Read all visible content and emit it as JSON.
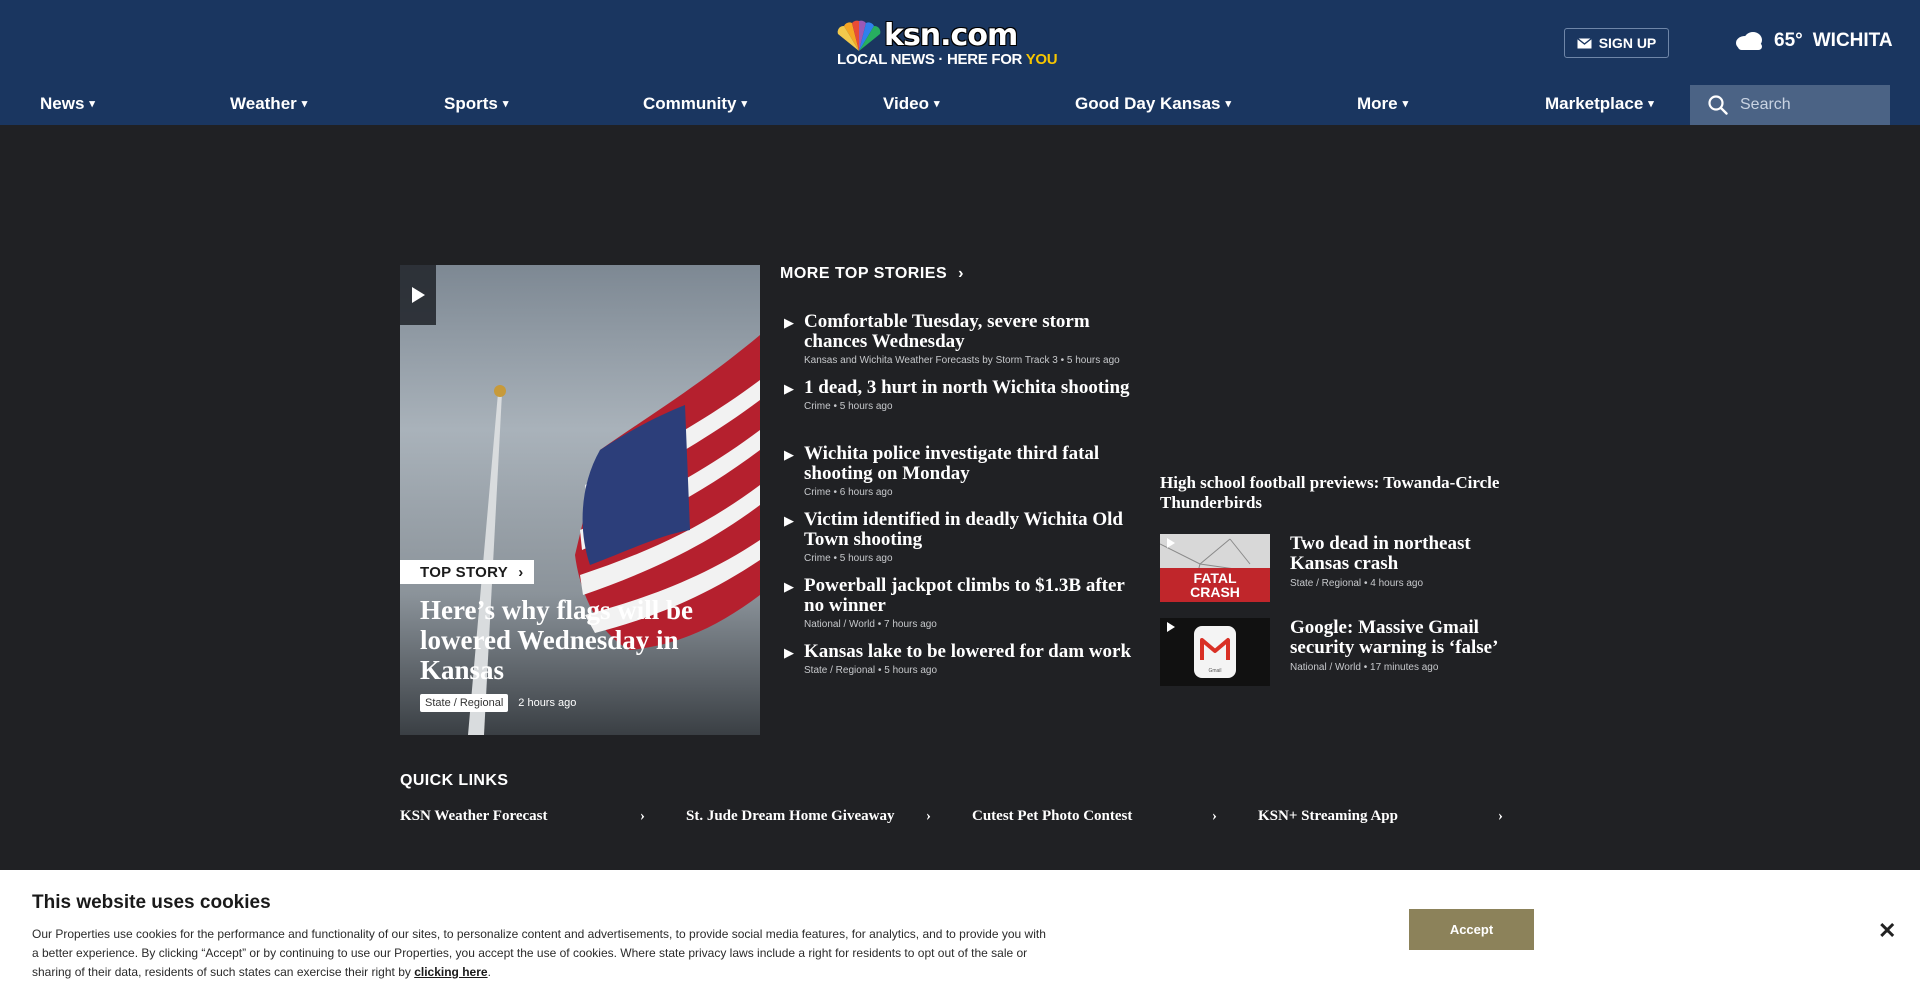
{
  "header": {
    "logo_text": "ksn.com",
    "logo_tagline_white": "LOCAL NEWS · HERE FOR ",
    "logo_tagline_yellow": "YOU",
    "signup_label": "SIGN UP",
    "weather": {
      "temp": "65°",
      "city": "WICHITA",
      "icon": "cloudy-icon"
    }
  },
  "nav": {
    "items": [
      "News",
      "Weather",
      "Sports",
      "Community",
      "Video",
      "Good Day Kansas",
      "More",
      "Marketplace"
    ],
    "search_placeholder": "Search"
  },
  "top_story": {
    "label": "TOP STORY",
    "headline": "Here’s why flags will be lowered Wednesday in Kansas",
    "tag": "State / Regional",
    "time": "2 hours ago"
  },
  "more_top_stories": {
    "title": "MORE TOP STORIES",
    "items": [
      {
        "headline": "Comfortable Tuesday, severe storm chances Wednesday",
        "category": "Kansas and Wichita Weather Forecasts by Storm Track 3",
        "time": "5 hours ago"
      },
      {
        "headline": "1 dead, 3 hurt in north Wichita shooting",
        "category": "Crime",
        "time": "5 hours ago"
      },
      {
        "headline": "Wichita police investigate third fatal shooting on Monday",
        "category": "Crime",
        "time": "6 hours ago"
      },
      {
        "headline": "Victim identified in deadly Wichita Old Town shooting",
        "category": "Crime",
        "time": "5 hours ago"
      },
      {
        "headline": "Powerball jackpot climbs to $1.3B after no winner",
        "category": "National / World",
        "time": "7 hours ago"
      },
      {
        "headline": "Kansas lake to be lowered for dam work",
        "category": "State / Regional",
        "time": "5 hours ago"
      }
    ]
  },
  "right_column": {
    "top_headline": "High school football previews: Towanda-Circle Thunderbirds",
    "cards": [
      {
        "headline": "Two dead in northeast Kansas crash",
        "category": "State / Regional",
        "time": "4 hours ago",
        "thumb_text": "FATAL CRASH"
      },
      {
        "headline": "Google: Massive Gmail security warning is ‘false’",
        "category": "National / World",
        "time": "17 minutes ago",
        "thumb_text": "Gmail"
      }
    ]
  },
  "quick_links": {
    "title": "QUICK LINKS",
    "items": [
      "KSN Weather Forecast",
      "St. Jude Dream Home Giveaway",
      "Cutest Pet Photo Contest",
      "KSN+ Streaming App"
    ]
  },
  "cookie": {
    "title": "This website uses cookies",
    "body": "Our Properties use cookies for the performance and functionality of our sites, to personalize content and advertisements, to provide social media features, for analytics, and to provide you with a better experience. By clicking “Accept” or by continuing to use our Properties, you accept the use of cookies. Where state privacy laws include a right for residents to opt out of the sale or sharing of their data, residents of such states can exercise their right by ",
    "link": "clicking here",
    "body_end": ".",
    "accept_label": "Accept",
    "close_glyph": "✕"
  },
  "colors": {
    "header_bg": "#1a3660",
    "page_bg": "#202124",
    "search_bg": "#4b6385",
    "accept_bg": "#8c825a"
  }
}
